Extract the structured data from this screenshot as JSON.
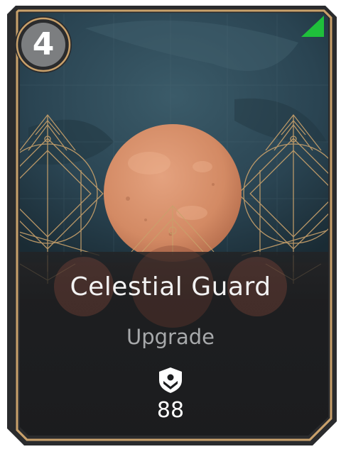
{
  "card": {
    "cost": "4",
    "title": "Celestial Guard",
    "type_label": "Upgrade",
    "stat_icon": "shield-icon",
    "stat_value": "88"
  },
  "colors": {
    "frame_gold": "#c9a16b",
    "frame_dark": "#2a2b2d",
    "art_blue": "#2d4a57",
    "planet": "#d8906a",
    "corner_flag": "#1fbf3b",
    "panel": "#1b1c1e",
    "title_text": "#f2f2f2",
    "type_text": "#a7a9ab"
  }
}
